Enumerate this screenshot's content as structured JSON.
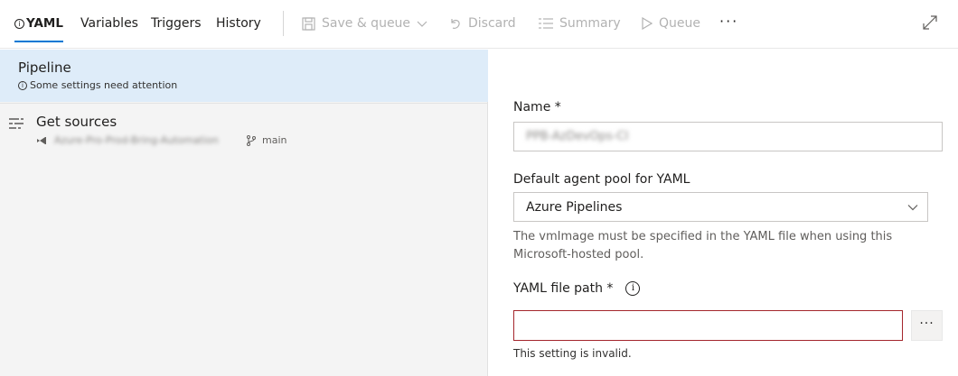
{
  "toolbar": {
    "tabs": [
      {
        "label": "YAML",
        "active": true,
        "icon": "info-icon"
      },
      {
        "label": "Variables"
      },
      {
        "label": "Triggers"
      },
      {
        "label": "History"
      }
    ],
    "actions": [
      {
        "label": "Save & queue",
        "icon": "save-icon",
        "enabled": false
      },
      {
        "label": "Discard",
        "icon": "undo-icon",
        "enabled": false
      },
      {
        "label": "Summary",
        "icon": "summary-icon",
        "enabled": false
      },
      {
        "label": "Queue",
        "icon": "play-icon",
        "enabled": false
      }
    ],
    "more": "···",
    "expand_icon": "expand-icon"
  },
  "left": {
    "pipeline": {
      "title": "Pipeline",
      "warning": "Some settings need attention"
    },
    "sources": {
      "title": "Get sources",
      "repo": "Azure-Pro-Prod-Bring-Automation",
      "branch": "main"
    }
  },
  "form": {
    "name_label": "Name *",
    "name_value": "PPB-AzDevOps-CI",
    "pool_label": "Default agent pool for YAML",
    "pool_value": "Azure Pipelines",
    "pool_help": "The vmImage must be specified in the YAML file when using this Microsoft-hosted pool.",
    "path_label": "YAML file path *",
    "path_value": "",
    "browse_label": "···",
    "error": "This setting is invalid."
  },
  "colors": {
    "accent": "#0078d4",
    "selected_bg": "#deecf9",
    "error_border": "#a4262c",
    "disabled_text": "#b2b2b2"
  }
}
